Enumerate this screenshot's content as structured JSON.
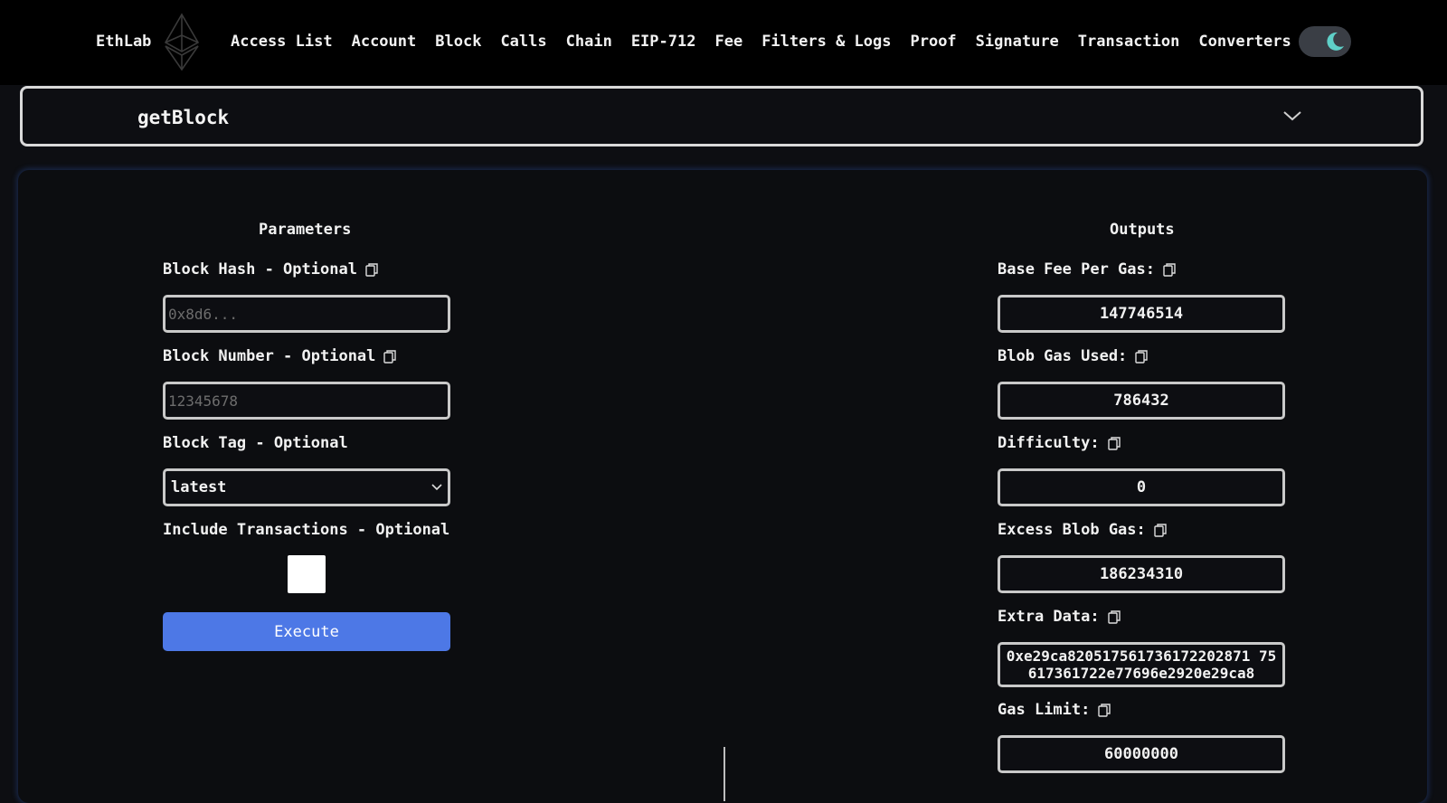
{
  "header": {
    "brand": "EthLab",
    "nav": [
      "Access List",
      "Account",
      "Block",
      "Calls",
      "Chain",
      "EIP-712",
      "Fee",
      "Filters & Logs",
      "Proof",
      "Signature",
      "Transaction",
      "Converters"
    ],
    "theme_toggle_icon": "moon-icon"
  },
  "method": {
    "name": "getBlock",
    "icon": "chevron-down-icon"
  },
  "parameters": {
    "title": "Parameters",
    "block_hash": {
      "label": "Block Hash - Optional",
      "placeholder": "0x8d6...",
      "value": ""
    },
    "block_number": {
      "label": "Block Number - Optional",
      "placeholder": "12345678",
      "value": ""
    },
    "block_tag": {
      "label": "Block Tag - Optional",
      "value": "latest"
    },
    "include_transactions": {
      "label": "Include Transactions - Optional",
      "checked": false
    },
    "execute_label": "Execute"
  },
  "outputs": {
    "title": "Outputs",
    "base_fee": {
      "label": "Base Fee Per Gas:",
      "value": "147746514"
    },
    "blob_gas_used": {
      "label": "Blob Gas Used:",
      "value": "786432"
    },
    "difficulty": {
      "label": "Difficulty:",
      "value": "0"
    },
    "excess_blob_gas": {
      "label": "Excess Blob Gas:",
      "value": "186234310"
    },
    "extra_data": {
      "label": "Extra Data:",
      "value": "0xe29ca820517561736172202871 75617361722e77696e2920e29ca8"
    },
    "gas_limit": {
      "label": "Gas Limit:",
      "value": "60000000"
    }
  },
  "colors": {
    "accent": "#4d78e6",
    "moon": "#5fd0c8"
  }
}
